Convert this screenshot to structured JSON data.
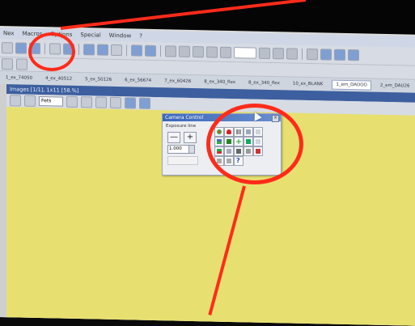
{
  "menubar": {
    "items": [
      "Nex",
      "Macros",
      "Options",
      "Special",
      "Window",
      "?"
    ]
  },
  "tabs": {
    "items": [
      {
        "label": "1_ex_74050"
      },
      {
        "label": "4_ex_40512"
      },
      {
        "label": "5_ex_50126"
      },
      {
        "label": "6_ex_56674"
      },
      {
        "label": "7_ex_60426"
      },
      {
        "label": "8_ex_340_flex"
      },
      {
        "label": "8_ex_340_flex"
      },
      {
        "label": "10_ex_BLANK"
      },
      {
        "label": "1_em_DAOOO",
        "active": true
      },
      {
        "label": "2_em_DAU26"
      }
    ]
  },
  "image_window": {
    "title": "Images [1/1], 1x11 [58.%]",
    "dropdown_value": "Fets"
  },
  "camera_control": {
    "title": "Camera Control",
    "exposure_label": "Exposure line",
    "minus": "—",
    "plus": "+",
    "value": "1.000"
  },
  "icons": {
    "help": "?"
  },
  "colors": {
    "highlight_circle": "#ff2b1a",
    "image_background": "#e7e070",
    "title_bar": "#3d5fa0"
  }
}
